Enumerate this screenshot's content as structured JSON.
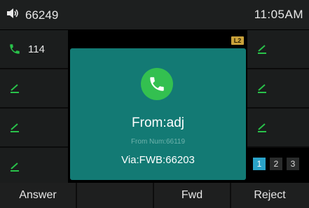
{
  "status": {
    "account": "66249",
    "time": "11:05AM",
    "volume_icon": "speaker-icon"
  },
  "left_lines": [
    {
      "label": "114",
      "icon": "phone-handset-icon",
      "color": "#29c24a"
    },
    {
      "label": "",
      "icon": "line-key-icon",
      "color": "#29c24a"
    },
    {
      "label": "",
      "icon": "line-key-icon",
      "color": "#29c24a"
    },
    {
      "label": "",
      "icon": "line-key-icon",
      "color": "#29c24a"
    }
  ],
  "right_lines": [
    {
      "label": "",
      "icon": "line-key-icon"
    },
    {
      "label": "",
      "icon": "line-key-icon"
    },
    {
      "label": "",
      "icon": "line-key-icon"
    }
  ],
  "badge": "L2",
  "incoming_call": {
    "from": "From:adj",
    "from_num": "From Num:66119",
    "via": "Via:FWB:66203",
    "accent": "#137a74"
  },
  "pages": [
    "1",
    "2",
    "3"
  ],
  "softkeys": [
    "Answer",
    "",
    "Fwd",
    "Reject"
  ]
}
